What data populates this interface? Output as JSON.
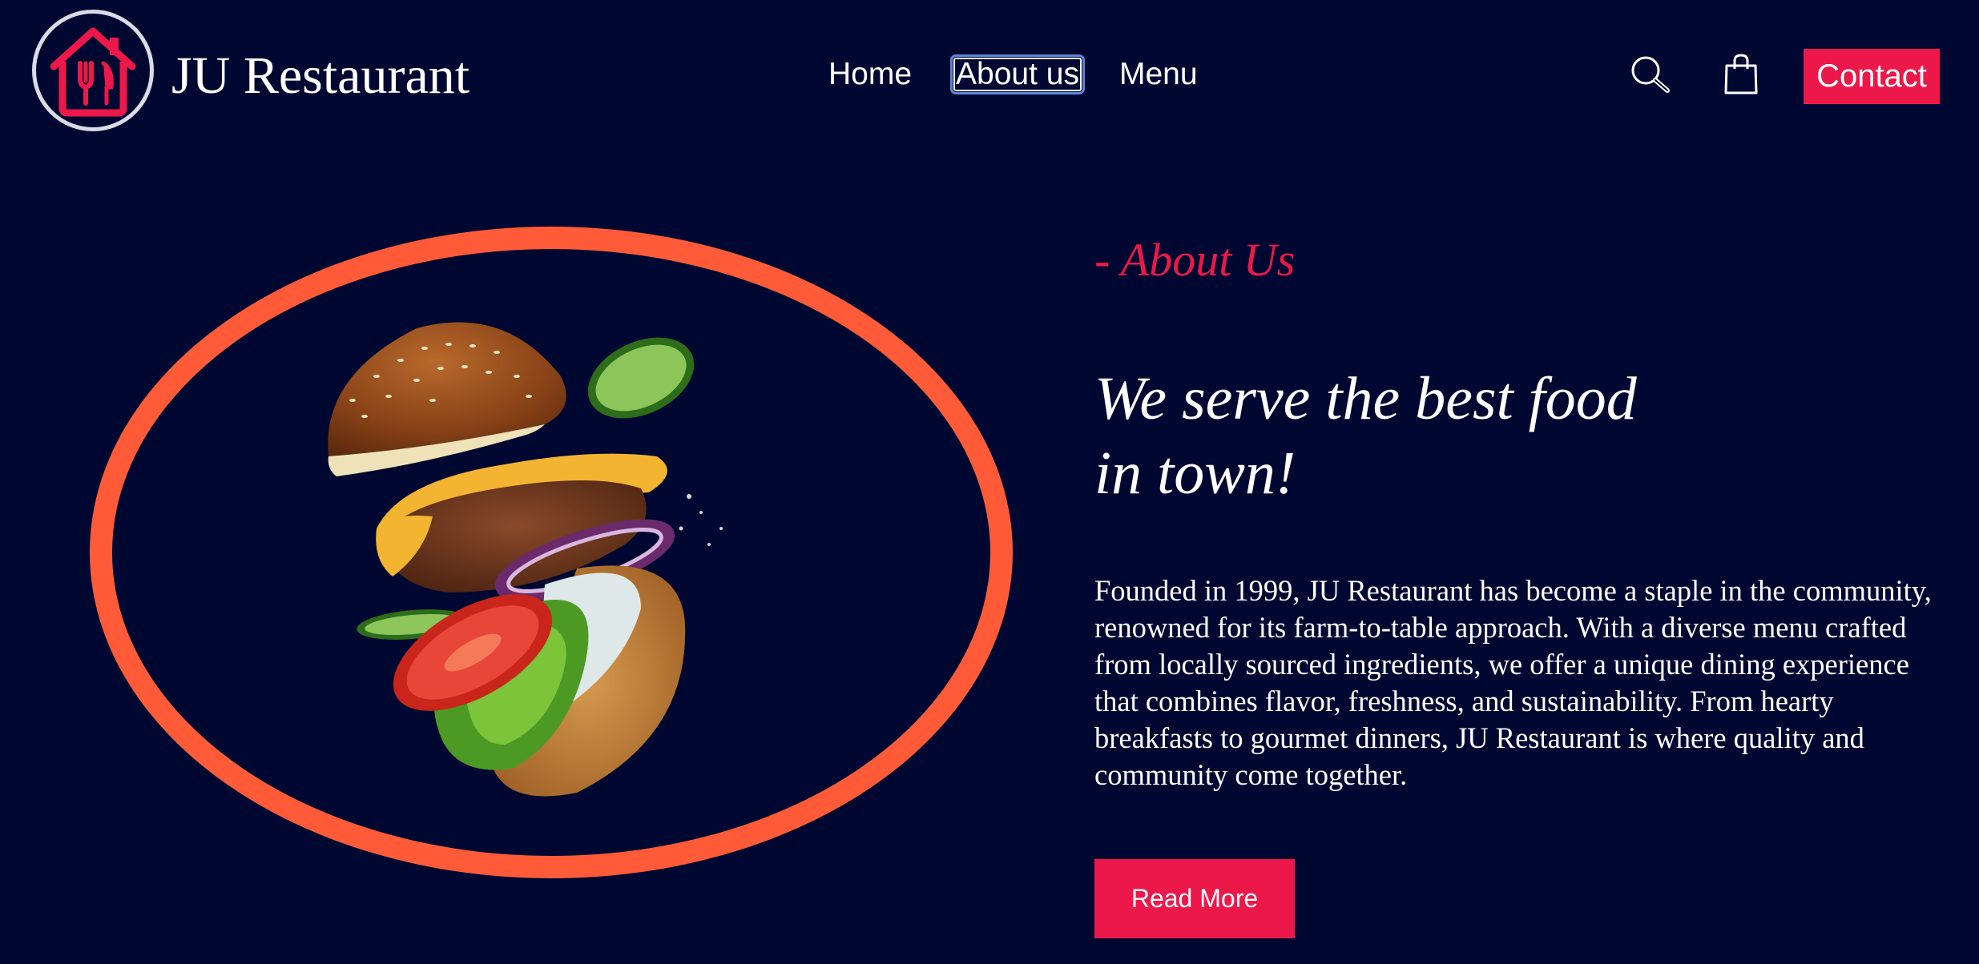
{
  "brand": {
    "name": "JU Restaurant",
    "logo_icon": "house-fork-knife-icon"
  },
  "nav": {
    "items": [
      {
        "label": "Home"
      },
      {
        "label": "About us"
      },
      {
        "label": "Menu"
      }
    ],
    "active": "About us"
  },
  "header_actions": {
    "search_icon": "search-icon",
    "cart_icon": "shopping-bag-icon",
    "contact_label": "Contact"
  },
  "hero": {
    "image": "flying-burger-image"
  },
  "about": {
    "kicker": "- About Us",
    "title_line1": "We serve the best food",
    "title_line2": "in town!",
    "body": "Founded in 1999, JU Restaurant has become a staple in the community, renowned for its farm-to-table approach. With a diverse menu crafted from locally sourced ingredients, we offer a unique dining experience that combines flavor, freshness, and sustainability. From hearty breakfasts to gourmet dinners, JU Restaurant is where quality and community come together.",
    "cta_label": "Read More"
  },
  "colors": {
    "background": "#000730",
    "accent": "#ec1849",
    "ring": "#ff5b39",
    "text": "#ffffff"
  }
}
